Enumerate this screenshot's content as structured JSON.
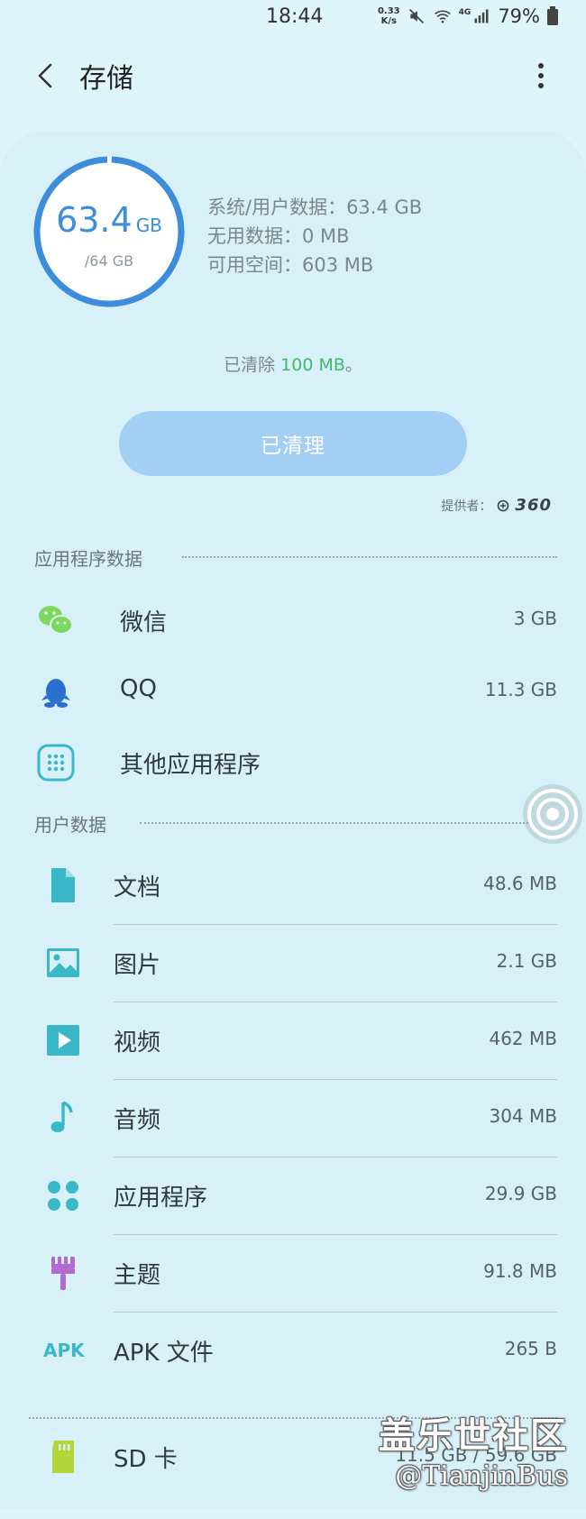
{
  "status_bar": {
    "time": "18:44",
    "net_speed_value": "0.33",
    "net_speed_unit": "K/s",
    "network": "4G",
    "battery": "79%"
  },
  "header": {
    "title": "存储"
  },
  "storage": {
    "used_value": "63.4",
    "used_unit": "GB",
    "total": "/64 GB",
    "used_fraction": 0.99,
    "system_user_data": "系统/用户数据：63.4 GB",
    "junk_data": "无用数据：0 MB",
    "available": "可用空间：603 MB",
    "cleared_prefix": "已清除 ",
    "cleared_amount": "100 MB",
    "cleared_suffix": "。",
    "clean_button": "已清理",
    "provider_label": "提供者：",
    "provider_logo": "360"
  },
  "app_data": {
    "heading": "应用程序数据",
    "items": [
      {
        "name": "微信",
        "size": "3 GB",
        "icon": "wechat-icon"
      },
      {
        "name": "QQ",
        "size": "11.3 GB",
        "icon": "qq-icon"
      },
      {
        "name": "其他应用程序",
        "size": "",
        "icon": "apps-grid-icon"
      }
    ]
  },
  "user_data": {
    "heading": "用户数据",
    "items": [
      {
        "name": "文档",
        "size": "48.6 MB",
        "icon": "document-icon"
      },
      {
        "name": "图片",
        "size": "2.1 GB",
        "icon": "image-icon"
      },
      {
        "name": "视频",
        "size": "462 MB",
        "icon": "video-icon"
      },
      {
        "name": "音频",
        "size": "304 MB",
        "icon": "music-note-icon"
      },
      {
        "name": "应用程序",
        "size": "29.9 GB",
        "icon": "app-dots-icon"
      },
      {
        "name": "主题",
        "size": "91.8 MB",
        "icon": "theme-brush-icon"
      },
      {
        "name": "APK 文件",
        "size": "265 B",
        "icon": "apk-icon",
        "icon_text": "APK"
      }
    ]
  },
  "sd_card": {
    "name": "SD 卡",
    "size": "11.5 GB / 59.6 GB"
  },
  "watermark": {
    "title": "盖乐世社区",
    "subtitle": "@TianjinBus"
  },
  "colors": {
    "background": "#def5fa",
    "ring": "#3d8ddc",
    "accent_green": "#3fba6b",
    "button": "#a3cff5",
    "icon_teal": "#3bb8c8"
  }
}
